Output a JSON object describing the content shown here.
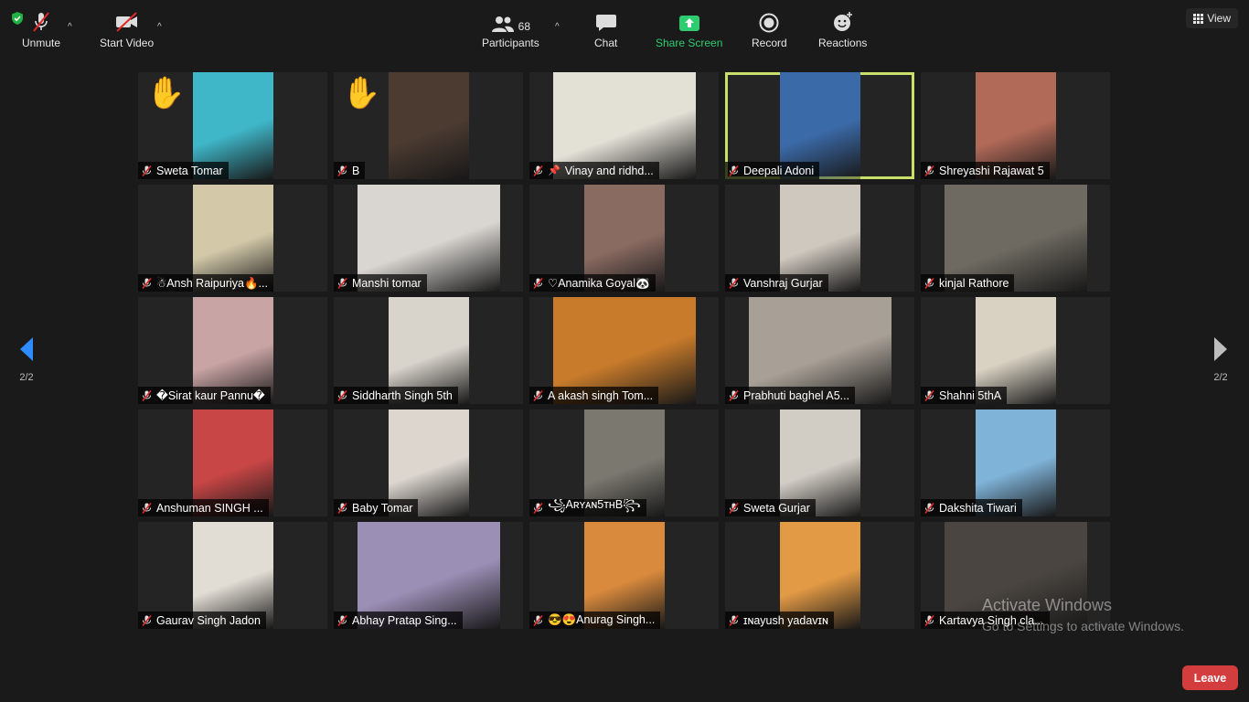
{
  "header": {
    "view_label": "View"
  },
  "pagination": {
    "left": "2/2",
    "right": "2/2"
  },
  "tiles": [
    {
      "name": "Sweta Tomar",
      "hand": "✋",
      "bg": "#3fb7c9",
      "layout": "narrow"
    },
    {
      "name": "B",
      "hand": "✋",
      "bg": "#4b3b31",
      "layout": "narrow"
    },
    {
      "name": "Vinay and ridhd...",
      "pin": "📌",
      "bg": "#e3e0d6",
      "layout": "wide"
    },
    {
      "name": "Deepali Adoni",
      "bg": "#3b6aa8",
      "layout": "narrow",
      "active": true
    },
    {
      "name": "Shreyashi Rajawat 5",
      "bg": "#b26a58",
      "layout": "narrow"
    },
    {
      "name": "☃Ansh Raipuriya🔥...",
      "bg": "#d3c9a9",
      "layout": "narrow"
    },
    {
      "name": "Manshi tomar",
      "bg": "#d9d6d1",
      "layout": "wide"
    },
    {
      "name": "♡Anamika Goyal🐼",
      "bg": "#8a6b62",
      "layout": "narrow"
    },
    {
      "name": "Vanshraj Gurjar",
      "bg": "#cfc8be",
      "layout": "narrow"
    },
    {
      "name": "kinjal Rathore",
      "bg": "#6e6a61",
      "layout": "wide"
    },
    {
      "name": "�Sirat kaur  Pannu�",
      "bg": "#c9a4a4",
      "layout": "narrow"
    },
    {
      "name": "Siddharth Singh 5th",
      "bg": "#d8d3cb",
      "layout": "narrow"
    },
    {
      "name": "A akash singh Tom...",
      "bg": "#c87b2b",
      "layout": "wide"
    },
    {
      "name": "Prabhuti baghel A5...",
      "bg": "#a8a096",
      "layout": "wide"
    },
    {
      "name": "Shahni 5thA",
      "bg": "#d9d2c3",
      "layout": "narrow"
    },
    {
      "name": "Anshuman SINGH ...",
      "bg": "#c94646",
      "layout": "narrow"
    },
    {
      "name": "Baby Tomar",
      "bg": "#dcd6cf",
      "layout": "narrow"
    },
    {
      "name": "꧁Aʀʏᴀɴ5ᴛʜB꧂",
      "bg": "#7a786f",
      "layout": "narrow"
    },
    {
      "name": "Sweta Gurjar",
      "bg": "#d1ccc4",
      "layout": "narrow"
    },
    {
      "name": "Dakshita Tiwari",
      "bg": "#7fb3d8",
      "layout": "narrow"
    },
    {
      "name": "Gaurav Singh Jadon",
      "bg": "#e2ddd4",
      "layout": "narrow"
    },
    {
      "name": "Abhay Pratap Sing...",
      "bg": "#9c8fb6",
      "layout": "wide"
    },
    {
      "name": "😎😍Anurag Singh...",
      "bg": "#d98a3d",
      "layout": "narrow"
    },
    {
      "name": "ɪɴayush yadavɪɴ",
      "bg": "#e39a45",
      "layout": "narrow"
    },
    {
      "name": "Kartavya Singh cla...",
      "bg": "#4a4540",
      "layout": "wide"
    }
  ],
  "watermark": {
    "title": "Activate Windows",
    "subtitle": "Go to Settings to activate Windows."
  },
  "toolbar": {
    "unmute": "Unmute",
    "start_video": "Start Video",
    "participants": "Participants",
    "participants_count": "68",
    "chat": "Chat",
    "share_screen": "Share Screen",
    "record": "Record",
    "reactions": "Reactions",
    "leave": "Leave"
  },
  "colors": {
    "active_border": "#c8e06a",
    "leave": "#d43d3d",
    "share": "#2ecc71"
  }
}
